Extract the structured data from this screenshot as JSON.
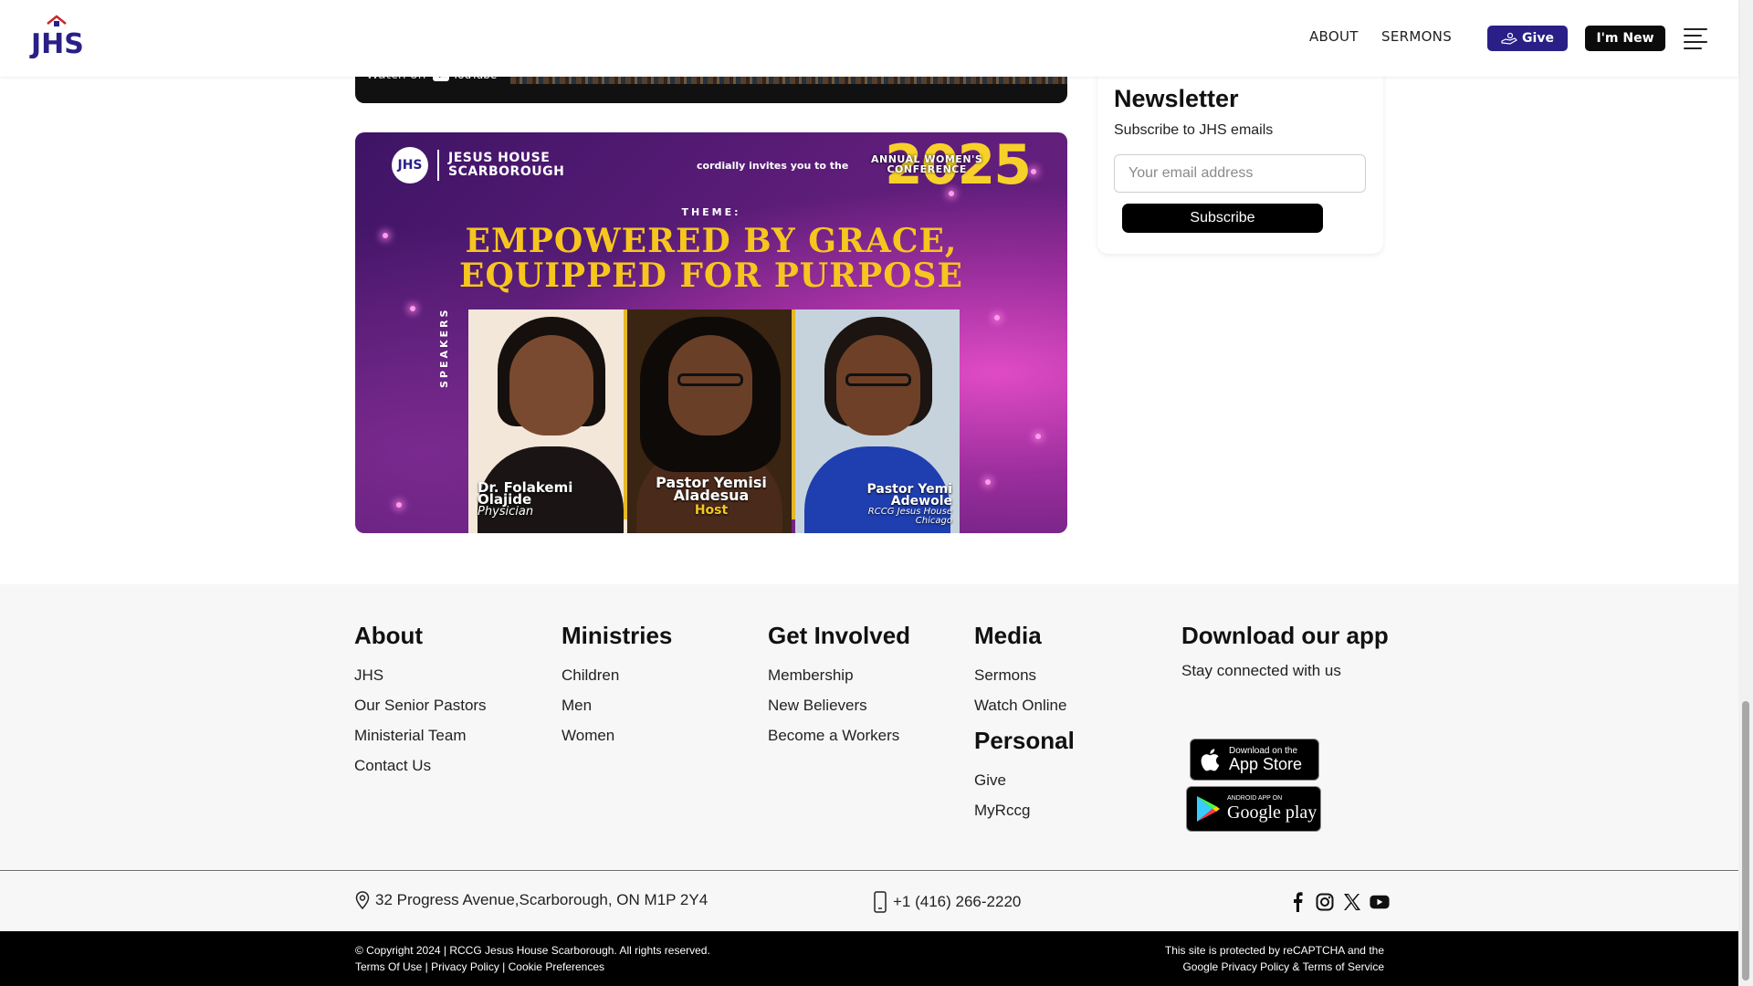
{
  "header": {
    "logo_text": "JHS",
    "nav": [
      "ABOUT",
      "SERMONS"
    ],
    "give_label": "Give",
    "new_label": "I'm New"
  },
  "video": {
    "watch_on": "Watch on",
    "youtube": "YouTube"
  },
  "banner": {
    "church_name_line1": "JESUS HOUSE",
    "church_name_line2": "SCARBOROUGH",
    "invite": "cordially invites you to the",
    "event_line1": "ANNUAL WOMEN'S",
    "event_line2": "CONFERENCE",
    "year": "2025",
    "theme_label": "THEME:",
    "theme_line1": "EMPOWERED BY GRACE,",
    "theme_line2": "EQUIPPED FOR PURPOSE",
    "speakers_label": "SPEAKERS",
    "speakers": [
      {
        "name_line1": "Dr. Folakemi",
        "name_line2": "Olajide",
        "role": "Physician",
        "role_line2": ""
      },
      {
        "name_line1": "Pastor Yemisi",
        "name_line2": "Aladesua",
        "role": "Host",
        "role_line2": ""
      },
      {
        "name_line1": "Pastor Yemi",
        "name_line2": "Adewole",
        "role": "RCCG Jesus House",
        "role_line2": "Chicago"
      }
    ]
  },
  "newsletter": {
    "title": "Newsletter",
    "subtitle": "Subscribe to JHS emails",
    "placeholder": "Your email address",
    "button": "Subscribe"
  },
  "footer": {
    "about": {
      "heading": "About",
      "links": [
        "JHS",
        "Our Senior Pastors",
        "Ministerial Team",
        "Contact Us"
      ]
    },
    "ministries": {
      "heading": "Ministries",
      "links": [
        "Children",
        "Men",
        "Women"
      ]
    },
    "involved": {
      "heading": "Get Involved",
      "links": [
        "Membership",
        "New Believers",
        "Become a Workers"
      ]
    },
    "media": {
      "heading": "Media",
      "links": [
        "Sermons",
        "Watch Online"
      ]
    },
    "personal": {
      "heading": "Personal",
      "links": [
        "Give",
        "MyRccg"
      ]
    },
    "app": {
      "heading": "Download our app",
      "subtitle": "Stay connected with us",
      "appstore_small": "Download on the",
      "appstore_big": "App Store",
      "play_small": "ANDROID APP ON",
      "play_big": "Google play"
    },
    "address": "32 Progress Avenue,Scarborough, ON M1P 2Y4",
    "phone": "+1 (416) 266-2220",
    "social_icons": [
      "facebook-icon",
      "instagram-icon",
      "x-icon",
      "youtube-icon"
    ]
  },
  "copyright": {
    "line1": "© Copyright 2024 | RCCG Jesus House Scarborough. All rights reserved.",
    "terms": "Terms Of Use",
    "privacy": "Privacy Policy",
    "cookies": "Cookie Preferences",
    "sep": " | ",
    "recaptcha_line1": "This site is protected by reCAPTCHA and the",
    "recaptcha_line2": "Google Privacy Policy & Terms of Service"
  },
  "colors": {
    "brand": "#2a1f86",
    "gold": "#f6c61e",
    "magenta": "#e04bc5"
  }
}
